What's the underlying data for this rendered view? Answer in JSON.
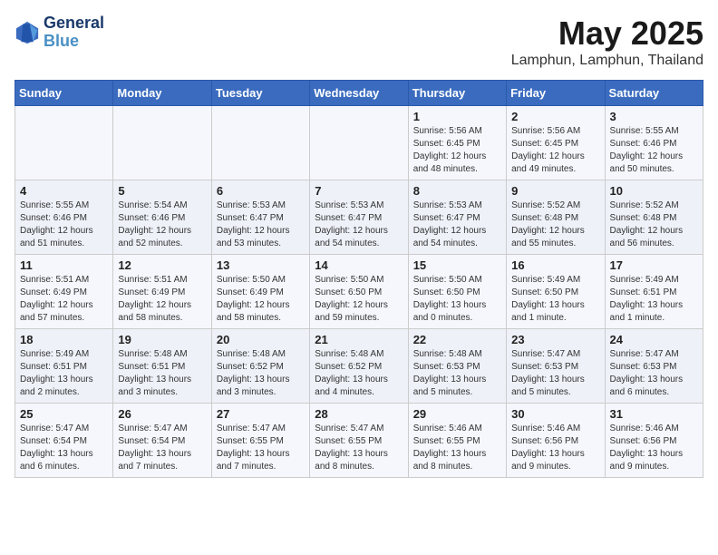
{
  "header": {
    "logo_line1": "General",
    "logo_line2": "Blue",
    "month_title": "May 2025",
    "location": "Lamphun, Lamphun, Thailand"
  },
  "days_of_week": [
    "Sunday",
    "Monday",
    "Tuesday",
    "Wednesday",
    "Thursday",
    "Friday",
    "Saturday"
  ],
  "weeks": [
    [
      {
        "day": "",
        "sunrise": "",
        "sunset": "",
        "daylight": ""
      },
      {
        "day": "",
        "sunrise": "",
        "sunset": "",
        "daylight": ""
      },
      {
        "day": "",
        "sunrise": "",
        "sunset": "",
        "daylight": ""
      },
      {
        "day": "",
        "sunrise": "",
        "sunset": "",
        "daylight": ""
      },
      {
        "day": "1",
        "sunrise": "Sunrise: 5:56 AM",
        "sunset": "Sunset: 6:45 PM",
        "daylight": "Daylight: 12 hours and 48 minutes."
      },
      {
        "day": "2",
        "sunrise": "Sunrise: 5:56 AM",
        "sunset": "Sunset: 6:45 PM",
        "daylight": "Daylight: 12 hours and 49 minutes."
      },
      {
        "day": "3",
        "sunrise": "Sunrise: 5:55 AM",
        "sunset": "Sunset: 6:46 PM",
        "daylight": "Daylight: 12 hours and 50 minutes."
      }
    ],
    [
      {
        "day": "4",
        "sunrise": "Sunrise: 5:55 AM",
        "sunset": "Sunset: 6:46 PM",
        "daylight": "Daylight: 12 hours and 51 minutes."
      },
      {
        "day": "5",
        "sunrise": "Sunrise: 5:54 AM",
        "sunset": "Sunset: 6:46 PM",
        "daylight": "Daylight: 12 hours and 52 minutes."
      },
      {
        "day": "6",
        "sunrise": "Sunrise: 5:53 AM",
        "sunset": "Sunset: 6:47 PM",
        "daylight": "Daylight: 12 hours and 53 minutes."
      },
      {
        "day": "7",
        "sunrise": "Sunrise: 5:53 AM",
        "sunset": "Sunset: 6:47 PM",
        "daylight": "Daylight: 12 hours and 54 minutes."
      },
      {
        "day": "8",
        "sunrise": "Sunrise: 5:53 AM",
        "sunset": "Sunset: 6:47 PM",
        "daylight": "Daylight: 12 hours and 54 minutes."
      },
      {
        "day": "9",
        "sunrise": "Sunrise: 5:52 AM",
        "sunset": "Sunset: 6:48 PM",
        "daylight": "Daylight: 12 hours and 55 minutes."
      },
      {
        "day": "10",
        "sunrise": "Sunrise: 5:52 AM",
        "sunset": "Sunset: 6:48 PM",
        "daylight": "Daylight: 12 hours and 56 minutes."
      }
    ],
    [
      {
        "day": "11",
        "sunrise": "Sunrise: 5:51 AM",
        "sunset": "Sunset: 6:49 PM",
        "daylight": "Daylight: 12 hours and 57 minutes."
      },
      {
        "day": "12",
        "sunrise": "Sunrise: 5:51 AM",
        "sunset": "Sunset: 6:49 PM",
        "daylight": "Daylight: 12 hours and 58 minutes."
      },
      {
        "day": "13",
        "sunrise": "Sunrise: 5:50 AM",
        "sunset": "Sunset: 6:49 PM",
        "daylight": "Daylight: 12 hours and 58 minutes."
      },
      {
        "day": "14",
        "sunrise": "Sunrise: 5:50 AM",
        "sunset": "Sunset: 6:50 PM",
        "daylight": "Daylight: 12 hours and 59 minutes."
      },
      {
        "day": "15",
        "sunrise": "Sunrise: 5:50 AM",
        "sunset": "Sunset: 6:50 PM",
        "daylight": "Daylight: 13 hours and 0 minutes."
      },
      {
        "day": "16",
        "sunrise": "Sunrise: 5:49 AM",
        "sunset": "Sunset: 6:50 PM",
        "daylight": "Daylight: 13 hours and 1 minute."
      },
      {
        "day": "17",
        "sunrise": "Sunrise: 5:49 AM",
        "sunset": "Sunset: 6:51 PM",
        "daylight": "Daylight: 13 hours and 1 minute."
      }
    ],
    [
      {
        "day": "18",
        "sunrise": "Sunrise: 5:49 AM",
        "sunset": "Sunset: 6:51 PM",
        "daylight": "Daylight: 13 hours and 2 minutes."
      },
      {
        "day": "19",
        "sunrise": "Sunrise: 5:48 AM",
        "sunset": "Sunset: 6:51 PM",
        "daylight": "Daylight: 13 hours and 3 minutes."
      },
      {
        "day": "20",
        "sunrise": "Sunrise: 5:48 AM",
        "sunset": "Sunset: 6:52 PM",
        "daylight": "Daylight: 13 hours and 3 minutes."
      },
      {
        "day": "21",
        "sunrise": "Sunrise: 5:48 AM",
        "sunset": "Sunset: 6:52 PM",
        "daylight": "Daylight: 13 hours and 4 minutes."
      },
      {
        "day": "22",
        "sunrise": "Sunrise: 5:48 AM",
        "sunset": "Sunset: 6:53 PM",
        "daylight": "Daylight: 13 hours and 5 minutes."
      },
      {
        "day": "23",
        "sunrise": "Sunrise: 5:47 AM",
        "sunset": "Sunset: 6:53 PM",
        "daylight": "Daylight: 13 hours and 5 minutes."
      },
      {
        "day": "24",
        "sunrise": "Sunrise: 5:47 AM",
        "sunset": "Sunset: 6:53 PM",
        "daylight": "Daylight: 13 hours and 6 minutes."
      }
    ],
    [
      {
        "day": "25",
        "sunrise": "Sunrise: 5:47 AM",
        "sunset": "Sunset: 6:54 PM",
        "daylight": "Daylight: 13 hours and 6 minutes."
      },
      {
        "day": "26",
        "sunrise": "Sunrise: 5:47 AM",
        "sunset": "Sunset: 6:54 PM",
        "daylight": "Daylight: 13 hours and 7 minutes."
      },
      {
        "day": "27",
        "sunrise": "Sunrise: 5:47 AM",
        "sunset": "Sunset: 6:55 PM",
        "daylight": "Daylight: 13 hours and 7 minutes."
      },
      {
        "day": "28",
        "sunrise": "Sunrise: 5:47 AM",
        "sunset": "Sunset: 6:55 PM",
        "daylight": "Daylight: 13 hours and 8 minutes."
      },
      {
        "day": "29",
        "sunrise": "Sunrise: 5:46 AM",
        "sunset": "Sunset: 6:55 PM",
        "daylight": "Daylight: 13 hours and 8 minutes."
      },
      {
        "day": "30",
        "sunrise": "Sunrise: 5:46 AM",
        "sunset": "Sunset: 6:56 PM",
        "daylight": "Daylight: 13 hours and 9 minutes."
      },
      {
        "day": "31",
        "sunrise": "Sunrise: 5:46 AM",
        "sunset": "Sunset: 6:56 PM",
        "daylight": "Daylight: 13 hours and 9 minutes."
      }
    ]
  ]
}
